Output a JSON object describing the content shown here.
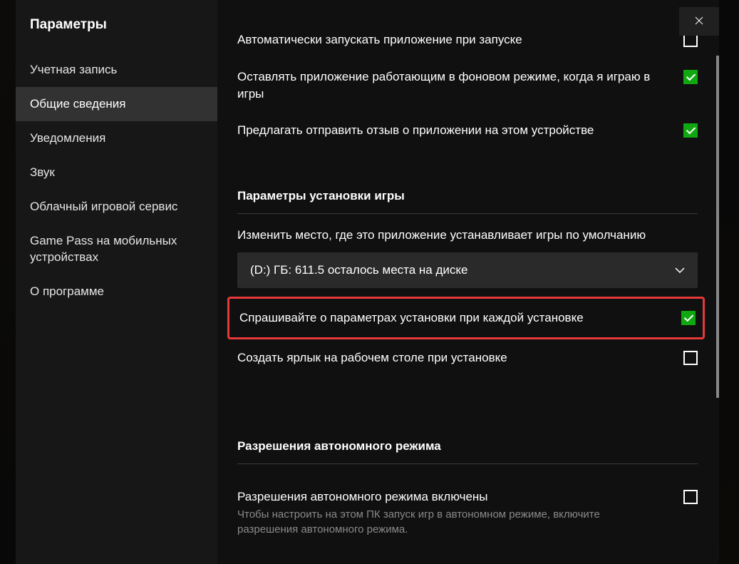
{
  "title": "Параметры",
  "sidebar": {
    "items": [
      {
        "label": "Учетная запись"
      },
      {
        "label": "Общие сведения"
      },
      {
        "label": "Уведомления"
      },
      {
        "label": "Звук"
      },
      {
        "label": "Облачный игровой сервис"
      },
      {
        "label": "Game Pass на мобильных устройствах"
      },
      {
        "label": "О программе"
      }
    ]
  },
  "startup": {
    "auto_launch": "Автоматически запускать приложение при запуске",
    "keep_running": "Оставлять приложение работающим в фоновом режиме, когда я играю в игры",
    "feedback": "Предлагать отправить отзыв о приложении на этом устройстве"
  },
  "install": {
    "header": "Параметры установки игры",
    "change_location": "Изменить место, где это приложение устанавливает игры по умолчанию",
    "drive_option": "(D:) ГБ: 611.5 осталось места на диске",
    "ask_each_time": "Спрашивайте о параметрах установки при каждой установке",
    "create_shortcut": "Создать ярлык на рабочем столе при установке"
  },
  "offline": {
    "header": "Разрешения автономного режима",
    "enabled_label": "Разрешения автономного режима включены",
    "enabled_desc": "Чтобы настроить на этом ПК запуск игр в автономном режиме, включите разрешения автономного режима."
  }
}
